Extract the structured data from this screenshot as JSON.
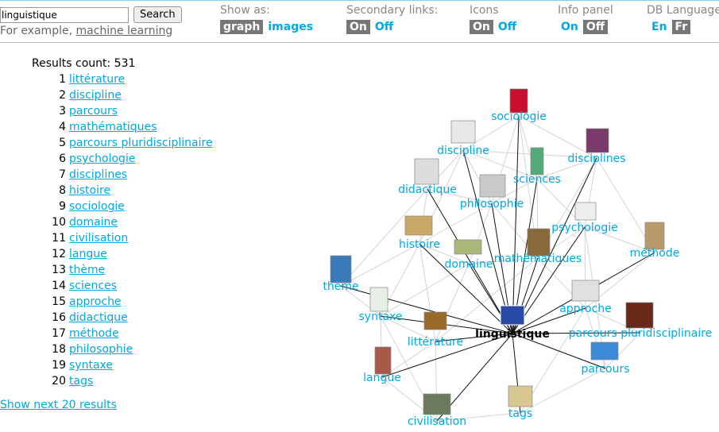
{
  "search": {
    "value": "linguistique",
    "button_label": "Search",
    "example_prefix": "For example, ",
    "example_link": "machine learning"
  },
  "controls": [
    {
      "label": "Show as:",
      "options": [
        "graph",
        "images"
      ],
      "selected": 0
    },
    {
      "label": "Secondary links:",
      "options": [
        "On",
        "Off"
      ],
      "selected": 0
    },
    {
      "label": "Icons",
      "options": [
        "On",
        "Off"
      ],
      "selected": 0
    },
    {
      "label": "Info panel",
      "options": [
        "On",
        "Off"
      ],
      "selected": 1
    },
    {
      "label": "DB Language",
      "options": [
        "En",
        "Fr"
      ],
      "selected": 1
    }
  ],
  "results": {
    "count_label": "Results count: 531",
    "items": [
      {
        "n": "1",
        "label": "littérature"
      },
      {
        "n": "2",
        "label": "discipline"
      },
      {
        "n": "3",
        "label": "parcours"
      },
      {
        "n": "4",
        "label": "mathématiques"
      },
      {
        "n": "5",
        "label": "parcours pluridisciplinaire"
      },
      {
        "n": "6",
        "label": "psychologie"
      },
      {
        "n": "7",
        "label": "disciplines"
      },
      {
        "n": "8",
        "label": "histoire"
      },
      {
        "n": "9",
        "label": "sociologie"
      },
      {
        "n": "10",
        "label": "domaine"
      },
      {
        "n": "11",
        "label": "civilisation"
      },
      {
        "n": "12",
        "label": "langue"
      },
      {
        "n": "13",
        "label": "thème"
      },
      {
        "n": "14",
        "label": "sciences"
      },
      {
        "n": "15",
        "label": "approche"
      },
      {
        "n": "16",
        "label": "didactique"
      },
      {
        "n": "17",
        "label": "méthode"
      },
      {
        "n": "18",
        "label": "philosophie"
      },
      {
        "n": "19",
        "label": "syntaxe"
      },
      {
        "n": "20",
        "label": "tags"
      }
    ],
    "show_next": "Show next 20 results"
  },
  "graph": {
    "center": "linguistique",
    "nodes": [
      "sociologie",
      "discipline",
      "disciplines",
      "didactique",
      "sciences",
      "philosophie",
      "psychologie",
      "histoire",
      "domaine",
      "mathématiques",
      "méthode",
      "thème",
      "approche",
      "syntaxe",
      "parcours pluridisciplinaire",
      "littérature",
      "parcours",
      "langue",
      "tags",
      "civilisation"
    ]
  }
}
